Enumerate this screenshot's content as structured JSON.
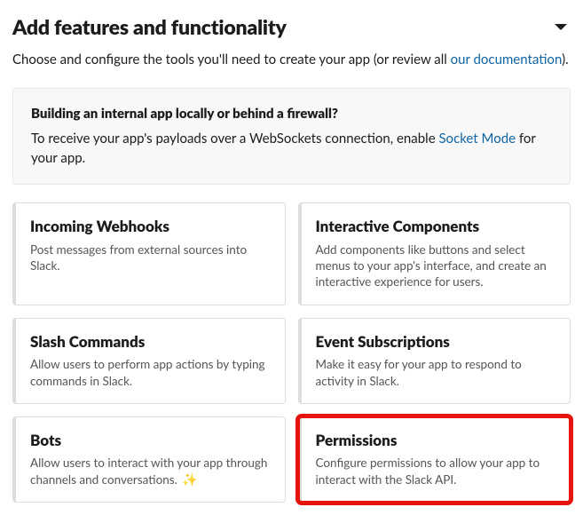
{
  "header": {
    "title": "Add features and functionality"
  },
  "intro": {
    "prefix": "Choose and configure the tools you'll need to create your app (or review all ",
    "link": "our documentation",
    "suffix": ")."
  },
  "notice": {
    "heading": "Building an internal app locally or behind a firewall?",
    "body_prefix": "To receive your app's payloads over a WebSockets connection, enable ",
    "body_link": "Socket Mode",
    "body_suffix": " for your app."
  },
  "cards": {
    "incoming_webhooks": {
      "title": "Incoming Webhooks",
      "desc": "Post messages from external sources into Slack."
    },
    "interactive_components": {
      "title": "Interactive Components",
      "desc": "Add components like buttons and select menus to your app's interface, and create an interactive experience for users."
    },
    "slash_commands": {
      "title": "Slash Commands",
      "desc": "Allow users to perform app actions by typing commands in Slack."
    },
    "event_subscriptions": {
      "title": "Event Subscriptions",
      "desc": "Make it easy for your app to respond to activity in Slack."
    },
    "bots": {
      "title": "Bots",
      "desc": "Allow users to interact with your app through channels and conversations."
    },
    "permissions": {
      "title": "Permissions",
      "desc": "Configure permissions to allow your app to interact with the Slack API."
    }
  },
  "icons": {
    "sparkle": "✨"
  }
}
